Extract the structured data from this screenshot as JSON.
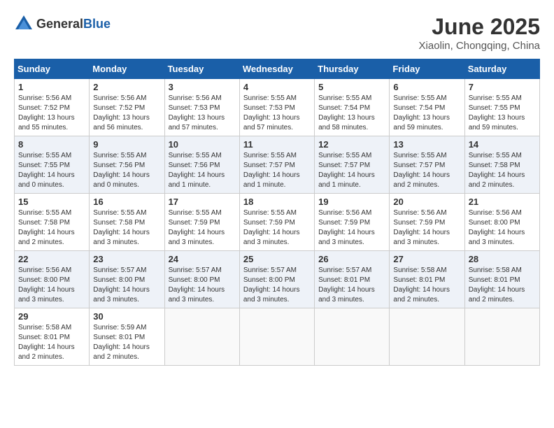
{
  "header": {
    "logo_general": "General",
    "logo_blue": "Blue",
    "month": "June 2025",
    "location": "Xiaolin, Chongqing, China"
  },
  "weekdays": [
    "Sunday",
    "Monday",
    "Tuesday",
    "Wednesday",
    "Thursday",
    "Friday",
    "Saturday"
  ],
  "weeks": [
    [
      {
        "day": "1",
        "sunrise": "5:56 AM",
        "sunset": "7:52 PM",
        "daylight": "13 hours and 55 minutes."
      },
      {
        "day": "2",
        "sunrise": "5:56 AM",
        "sunset": "7:52 PM",
        "daylight": "13 hours and 56 minutes."
      },
      {
        "day": "3",
        "sunrise": "5:56 AM",
        "sunset": "7:53 PM",
        "daylight": "13 hours and 57 minutes."
      },
      {
        "day": "4",
        "sunrise": "5:55 AM",
        "sunset": "7:53 PM",
        "daylight": "13 hours and 57 minutes."
      },
      {
        "day": "5",
        "sunrise": "5:55 AM",
        "sunset": "7:54 PM",
        "daylight": "13 hours and 58 minutes."
      },
      {
        "day": "6",
        "sunrise": "5:55 AM",
        "sunset": "7:54 PM",
        "daylight": "13 hours and 59 minutes."
      },
      {
        "day": "7",
        "sunrise": "5:55 AM",
        "sunset": "7:55 PM",
        "daylight": "13 hours and 59 minutes."
      }
    ],
    [
      {
        "day": "8",
        "sunrise": "5:55 AM",
        "sunset": "7:55 PM",
        "daylight": "14 hours and 0 minutes."
      },
      {
        "day": "9",
        "sunrise": "5:55 AM",
        "sunset": "7:56 PM",
        "daylight": "14 hours and 0 minutes."
      },
      {
        "day": "10",
        "sunrise": "5:55 AM",
        "sunset": "7:56 PM",
        "daylight": "14 hours and 1 minute."
      },
      {
        "day": "11",
        "sunrise": "5:55 AM",
        "sunset": "7:57 PM",
        "daylight": "14 hours and 1 minute."
      },
      {
        "day": "12",
        "sunrise": "5:55 AM",
        "sunset": "7:57 PM",
        "daylight": "14 hours and 1 minute."
      },
      {
        "day": "13",
        "sunrise": "5:55 AM",
        "sunset": "7:57 PM",
        "daylight": "14 hours and 2 minutes."
      },
      {
        "day": "14",
        "sunrise": "5:55 AM",
        "sunset": "7:58 PM",
        "daylight": "14 hours and 2 minutes."
      }
    ],
    [
      {
        "day": "15",
        "sunrise": "5:55 AM",
        "sunset": "7:58 PM",
        "daylight": "14 hours and 2 minutes."
      },
      {
        "day": "16",
        "sunrise": "5:55 AM",
        "sunset": "7:58 PM",
        "daylight": "14 hours and 3 minutes."
      },
      {
        "day": "17",
        "sunrise": "5:55 AM",
        "sunset": "7:59 PM",
        "daylight": "14 hours and 3 minutes."
      },
      {
        "day": "18",
        "sunrise": "5:55 AM",
        "sunset": "7:59 PM",
        "daylight": "14 hours and 3 minutes."
      },
      {
        "day": "19",
        "sunrise": "5:56 AM",
        "sunset": "7:59 PM",
        "daylight": "14 hours and 3 minutes."
      },
      {
        "day": "20",
        "sunrise": "5:56 AM",
        "sunset": "7:59 PM",
        "daylight": "14 hours and 3 minutes."
      },
      {
        "day": "21",
        "sunrise": "5:56 AM",
        "sunset": "8:00 PM",
        "daylight": "14 hours and 3 minutes."
      }
    ],
    [
      {
        "day": "22",
        "sunrise": "5:56 AM",
        "sunset": "8:00 PM",
        "daylight": "14 hours and 3 minutes."
      },
      {
        "day": "23",
        "sunrise": "5:57 AM",
        "sunset": "8:00 PM",
        "daylight": "14 hours and 3 minutes."
      },
      {
        "day": "24",
        "sunrise": "5:57 AM",
        "sunset": "8:00 PM",
        "daylight": "14 hours and 3 minutes."
      },
      {
        "day": "25",
        "sunrise": "5:57 AM",
        "sunset": "8:00 PM",
        "daylight": "14 hours and 3 minutes."
      },
      {
        "day": "26",
        "sunrise": "5:57 AM",
        "sunset": "8:01 PM",
        "daylight": "14 hours and 3 minutes."
      },
      {
        "day": "27",
        "sunrise": "5:58 AM",
        "sunset": "8:01 PM",
        "daylight": "14 hours and 2 minutes."
      },
      {
        "day": "28",
        "sunrise": "5:58 AM",
        "sunset": "8:01 PM",
        "daylight": "14 hours and 2 minutes."
      }
    ],
    [
      {
        "day": "29",
        "sunrise": "5:58 AM",
        "sunset": "8:01 PM",
        "daylight": "14 hours and 2 minutes."
      },
      {
        "day": "30",
        "sunrise": "5:59 AM",
        "sunset": "8:01 PM",
        "daylight": "14 hours and 2 minutes."
      },
      null,
      null,
      null,
      null,
      null
    ]
  ],
  "labels": {
    "sunrise": "Sunrise:",
    "sunset": "Sunset:",
    "daylight": "Daylight:"
  }
}
